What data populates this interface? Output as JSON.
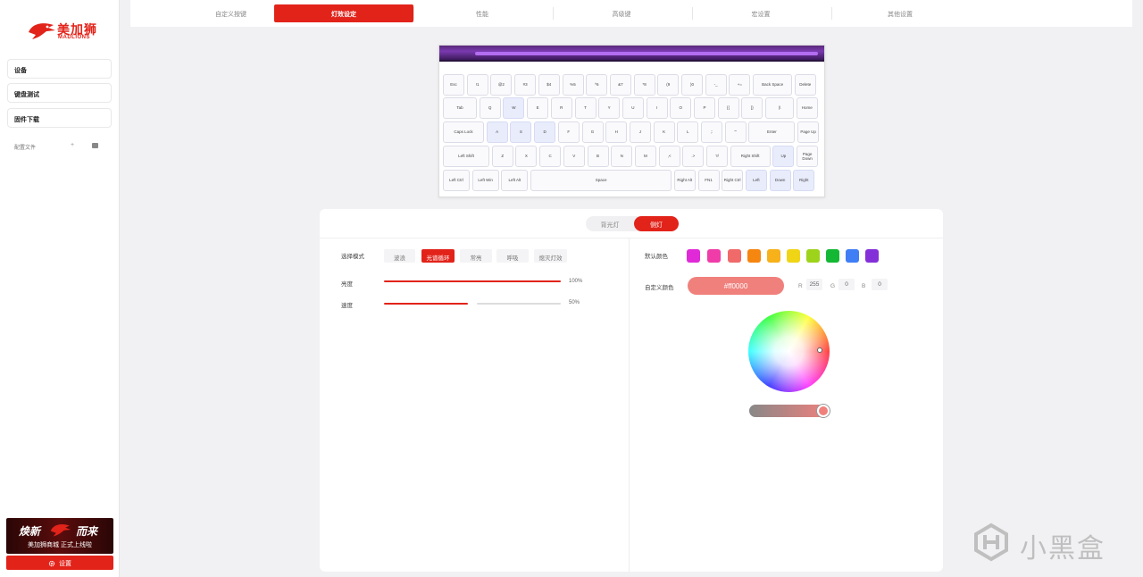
{
  "brand": {
    "name_cn": "美加狮",
    "name_en": "MADLIONS",
    "color": "#e2231a"
  },
  "sidebar": {
    "items": [
      {
        "label": "设备"
      },
      {
        "label": "键盘测试"
      },
      {
        "label": "固件下载"
      }
    ],
    "config_label": "配置文件",
    "config_add": "+",
    "banner": {
      "left": "焕新",
      "right": "而来",
      "sub": "美加狮商城 正式上线啦"
    },
    "settings_label": "设置"
  },
  "tabs": [
    {
      "label": "自定义按键",
      "active": false
    },
    {
      "label": "灯效设定",
      "active": true
    },
    {
      "label": "性能",
      "active": false
    },
    {
      "label": "高级键",
      "active": false
    },
    {
      "label": "宏设置",
      "active": false
    },
    {
      "label": "其他设置",
      "active": false
    }
  ],
  "keyboard": {
    "rows": [
      [
        "Esc",
        "!1",
        "@2",
        "#3",
        "$4",
        "%5",
        "^6",
        "&7",
        "*8",
        "(9",
        ")0",
        "-_",
        "+=",
        "Back Space",
        "Delete"
      ],
      [
        "Tab",
        "Q",
        "W",
        "E",
        "R",
        "T",
        "Y",
        "U",
        "I",
        "O",
        "P",
        "[{",
        "]}",
        "|\\",
        "Home"
      ],
      [
        "Caps Lock",
        "A",
        "S",
        "D",
        "F",
        "G",
        "H",
        "J",
        "K",
        "L",
        ";:",
        "\"'",
        "Enter",
        "Page Up"
      ],
      [
        "Left Shift",
        "Z",
        "X",
        "C",
        "V",
        "B",
        "N",
        "M",
        ",<",
        ".>",
        "?/",
        "Right Shift",
        "Up",
        "Page Down"
      ],
      [
        "Left Ctrl",
        "Left Win",
        "Left Alt",
        "Space",
        "Right Alt",
        "FN1",
        "Right Ctrl",
        "Left",
        "Down",
        "Right"
      ]
    ]
  },
  "light": {
    "segments": [
      {
        "label": "背光灯",
        "active": false
      },
      {
        "label": "侧灯",
        "active": true
      }
    ],
    "mode_label": "选择模式",
    "modes": [
      {
        "label": "波浪",
        "active": false
      },
      {
        "label": "光谱循环",
        "active": true
      },
      {
        "label": "常亮",
        "active": false
      },
      {
        "label": "呼吸",
        "active": false
      },
      {
        "label": "熄灭灯效",
        "active": false
      }
    ],
    "brightness": {
      "label": "亮度",
      "value": 1.0,
      "text": "100%"
    },
    "speed": {
      "label": "速度",
      "value": 0.5,
      "text": "50%"
    },
    "default_color_label": "默认颜色",
    "default_colors": [
      "#e02ad8",
      "#f03ca8",
      "#f06a6a",
      "#f5860f",
      "#f7b11a",
      "#f0d516",
      "#9ed31c",
      "#14b834",
      "#3f7ef5",
      "#8430d8"
    ],
    "custom_color_label": "自定义颜色",
    "custom_hex": "#ff0000",
    "custom_swatch": "#f0807c",
    "rgb": {
      "r_label": "R",
      "r": "255",
      "g_label": "G",
      "g": "0",
      "b_label": "B",
      "b": "0"
    }
  },
  "watermark": "小黑盒"
}
